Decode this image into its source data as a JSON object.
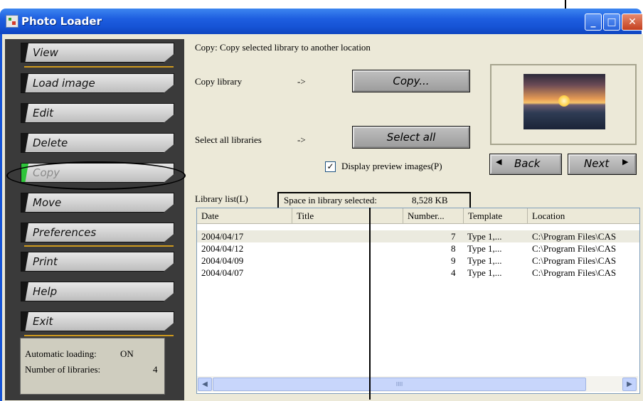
{
  "window": {
    "title": "Photo Loader",
    "min": "_",
    "max": "□",
    "close": "✕"
  },
  "sidebar": {
    "items": [
      {
        "label": "View"
      },
      {
        "label": "Load image"
      },
      {
        "label": "Edit"
      },
      {
        "label": "Delete"
      },
      {
        "label": "Copy",
        "active": true
      },
      {
        "label": "Move"
      },
      {
        "label": "Preferences"
      },
      {
        "label": "Print"
      },
      {
        "label": "Help"
      },
      {
        "label": "Exit"
      }
    ],
    "status": {
      "auto_label": "Automatic loading:",
      "auto_value": "ON",
      "count_label": "Number of libraries:",
      "count_value": "4"
    }
  },
  "main": {
    "heading": "Copy: Copy selected library to another location",
    "copy_label": "Copy library",
    "copy_arrow": "->",
    "copy_button": "Copy...",
    "select_label": "Select all libraries",
    "select_arrow": "->",
    "select_button": "Select all",
    "preview_checkbox": "Display preview images(P)",
    "preview_checked": true,
    "back_button": "Back",
    "next_button": "Next",
    "library_list_label": "Library list(L)",
    "space_label": "Space in library selected:",
    "space_value": "8,528 KB"
  },
  "table": {
    "columns": [
      "Date",
      "Title",
      "Number...",
      "Template",
      "Location"
    ],
    "rows": [
      {
        "date": "2004/04/17",
        "title": "",
        "number": "7",
        "template": "Type 1,...",
        "location": "C:\\Program Files\\CAS",
        "selected": true
      },
      {
        "date": "2004/04/12",
        "title": "",
        "number": "8",
        "template": "Type 1,...",
        "location": "C:\\Program Files\\CAS"
      },
      {
        "date": "2004/04/09",
        "title": "",
        "number": "9",
        "template": "Type 1,...",
        "location": "C:\\Program Files\\CAS"
      },
      {
        "date": "2004/04/07",
        "title": "",
        "number": "4",
        "template": "Type 1,...",
        "location": "C:\\Program Files\\CAS"
      }
    ],
    "scroll_grip": "IIII",
    "scroll_left": "◀",
    "scroll_right": "▶"
  }
}
